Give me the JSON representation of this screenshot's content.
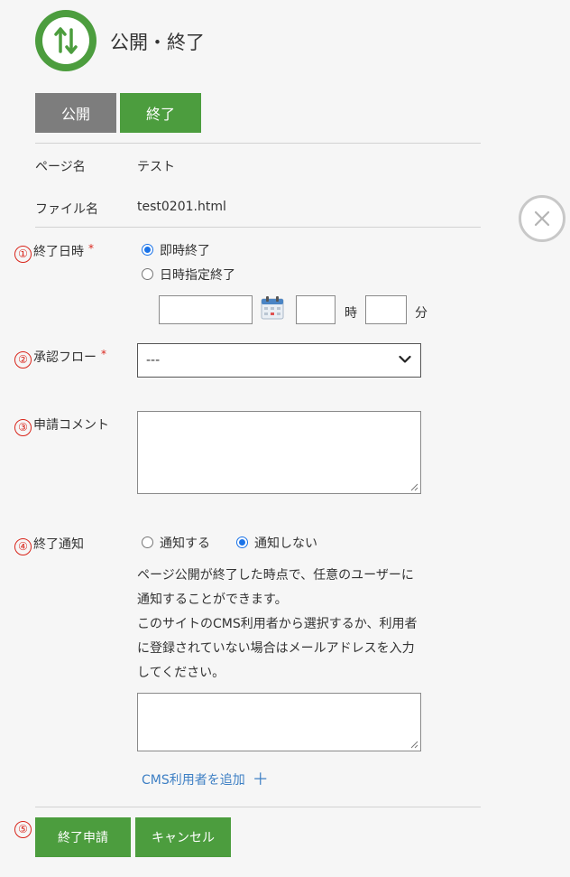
{
  "header": {
    "title": "公開・終了",
    "icon": "publish-toggle-arrows-icon"
  },
  "tabs": [
    {
      "label": "公開"
    },
    {
      "label": "終了"
    }
  ],
  "info": {
    "page_name_label": "ページ名",
    "page_name_value": "テスト",
    "file_name_label": "ファイル名",
    "file_name_value": "test0201.html"
  },
  "end_datetime": {
    "number": "①",
    "label": "終了日時",
    "required_mark": "*",
    "option_immediate": "即時終了",
    "option_scheduled": "日時指定終了",
    "selected": "即時終了",
    "date_value": "",
    "hour_value": "",
    "hour_unit": "時",
    "minute_value": "",
    "minute_unit": "分",
    "calendar_icon": "calendar-icon"
  },
  "approval_flow": {
    "number": "②",
    "label": "承認フロー",
    "required_mark": "*",
    "selected": "---"
  },
  "comment": {
    "number": "③",
    "label": "申請コメント",
    "value": ""
  },
  "notify": {
    "number": "④",
    "label": "終了通知",
    "option_yes": "通知する",
    "option_no": "通知しない",
    "selected": "通知しない",
    "help_lines": [
      "ページ公開が終了した時点で、任意のユーザーに",
      "通知することができます。",
      "このサイトのCMS利用者から選択するか、利用者",
      "に登録されていない場合はメールアドレスを入力",
      "してください。"
    ],
    "recipients_value": "",
    "add_link": "CMS利用者を追加",
    "add_symbol": "＋"
  },
  "actions": {
    "number": "⑤",
    "submit": "終了申請",
    "cancel": "キャンセル"
  },
  "colors": {
    "brand_green": "#4c9d3e",
    "tab_gray": "#7d7d7d",
    "required_red": "#d9261c",
    "link_blue": "#3d7fc4",
    "radio_blue": "#1a73e8"
  }
}
